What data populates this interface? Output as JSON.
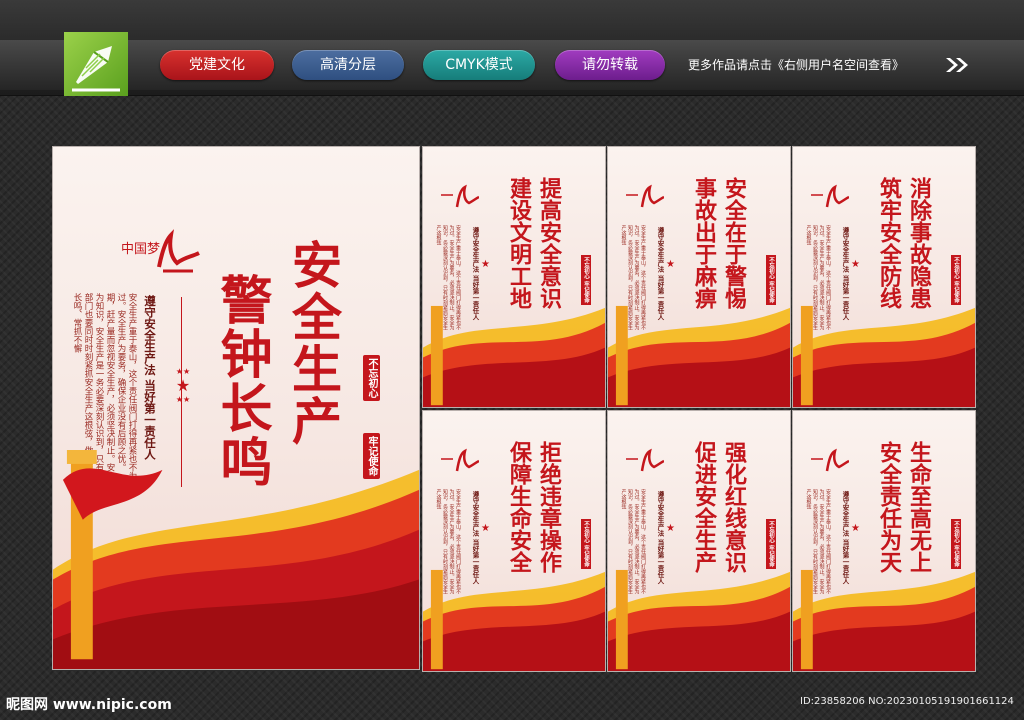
{
  "header": {
    "tags": [
      "党建文化",
      "高清分层",
      "CMYK模式",
      "请勿转载"
    ],
    "more_text": "更多作品请点击《右侧用户名空间查看》",
    "icons": {
      "logo": "pen-nib-logo-icon",
      "arrow": "double-chevron-right-icon"
    },
    "colors": {
      "red": "#c4161c",
      "blue": "#2f4f80",
      "teal": "#167d7a",
      "purple": "#6d1d8d",
      "logo_green": "#7cc13a"
    }
  },
  "main_poster": {
    "title_line1": "安全生产",
    "title_line2": "警钟长鸣",
    "law_text": "遵守安全生产法 当好第一责任人",
    "body_text": "安全生产重于泰山，这个责任阀门打得再紧也不为过。安全生产为要务，确保企业没有后顾之忧。期，赶产量而忽视安全生产，必须坚决制止。安全为知识，安全生产是一务必要深刻认识到，只有关部门也要同时时刻紧抓安全生产这根弦，做到警钟长鸣、常抓不懈",
    "seal_1": "不忘初心",
    "seal_2": "牢记使命",
    "logo_text": "中国梦"
  },
  "small_posters": [
    {
      "line1": "提高安全意识",
      "line2": "建设文明工地"
    },
    {
      "line1": "安全在于警惕",
      "line2": "事故出于麻痹"
    },
    {
      "line1": "消除事故隐患",
      "line2": "筑牢安全防线"
    },
    {
      "line1": "拒绝违章操作",
      "line2": "保障生命安全"
    },
    {
      "line1": "强化红线意识",
      "line2": "促进安全生产"
    },
    {
      "line1": "生命至高无上",
      "line2": "安全责任为天"
    }
  ],
  "small_common": {
    "law_text": "遵守安全生产法 当好第一责任人",
    "body_text": "安全生产重于泰山，这个责任阀门打得再紧也不为过。安全生产为要务，必须坚决制止。安全为知识，务必要深刻认识到，只有时刻紧抓安全生产这根弦",
    "seal": "不忘初心 牢记使命"
  },
  "footer": {
    "brand": "昵图网 www.nipic.com",
    "id_text": "ID:23858206 NO:20230105191901661124"
  }
}
